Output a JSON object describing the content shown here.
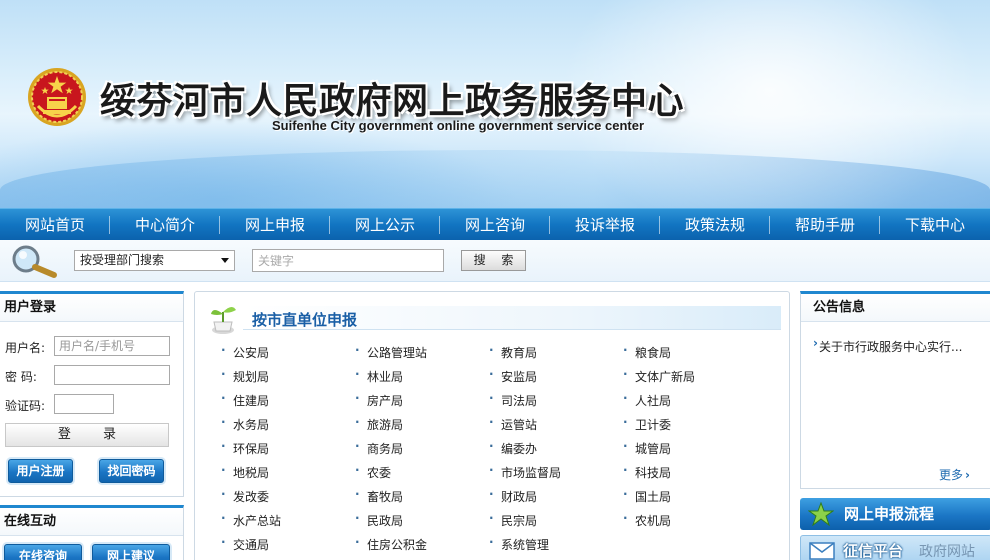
{
  "header": {
    "title": "绥芬河市人民政府网上政务服务中心",
    "subtitle": "Suifenhe City government online government service center"
  },
  "nav": {
    "items": [
      "网站首页",
      "中心简介",
      "网上申报",
      "网上公示",
      "网上咨询",
      "投诉举报",
      "政策法规",
      "帮助手册",
      "下载中心"
    ]
  },
  "search": {
    "dept_select": "按受理部门搜索",
    "keyword_placeholder": "关键字",
    "button": "搜 索"
  },
  "login": {
    "title": "用户登录",
    "username_label": "用户名:",
    "username_placeholder": "用户名/手机号",
    "password_label": "密 码:",
    "captcha_label": "验证码:",
    "login_button": "登 录",
    "register_button": "用户注册",
    "recover_button": "找回密码"
  },
  "interact": {
    "title": "在线互动",
    "consult_button": "在线咨询",
    "suggest_button": "网上建议"
  },
  "center": {
    "title": "按市直单位申报",
    "columns": [
      [
        "公安局",
        "规划局",
        "住建局",
        "水务局",
        "环保局",
        "地税局",
        "发改委",
        "水产总站",
        "交通局"
      ],
      [
        "公路管理站",
        "林业局",
        "房产局",
        "旅游局",
        "商务局",
        "农委",
        "畜牧局",
        "民政局",
        "住房公积金"
      ],
      [
        "教育局",
        "安监局",
        "司法局",
        "运管站",
        "编委办",
        "市场监督局",
        "财政局",
        "民宗局",
        "系统管理"
      ],
      [
        "粮食局",
        "文体广新局",
        "人社局",
        "卫计委",
        "城管局",
        "科技局",
        "国土局",
        "农机局"
      ]
    ]
  },
  "notice": {
    "title": "公告信息",
    "items": [
      "关于市行政服务中心实行..."
    ],
    "more": "更多"
  },
  "right_buttons": {
    "flow": "网上申报流程",
    "letter": "征信平台",
    "letter_watermark": "政府网站"
  },
  "colors": {
    "nav_blue": "#1275c2",
    "accent_blue": "#1f87cf",
    "title_blue": "#1a5fa6"
  }
}
